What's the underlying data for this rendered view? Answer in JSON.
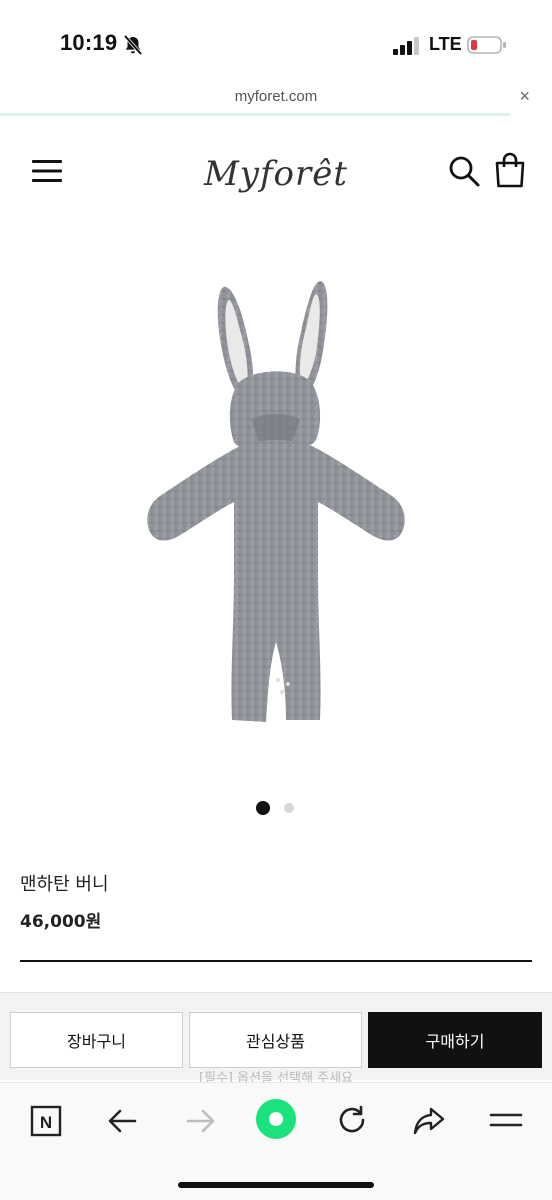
{
  "status_bar": {
    "time": "10:19",
    "network": "LTE",
    "battery_color": "#e0383e"
  },
  "url_bar": {
    "url": "myforet.com",
    "close": "×"
  },
  "header": {
    "logo_text": "Myforêt"
  },
  "gallery": {
    "image_alt": "gray bunny-ear hooded baby romper",
    "total_slides": 2,
    "active_slide": 1
  },
  "product": {
    "name": "맨하탄 버니",
    "price": "46,000원"
  },
  "actions": {
    "cart_label": "장바구니",
    "wish_label": "관심상품",
    "buy_label": "구매하기",
    "required_note": "[필수] 옵션을 선택해 주세요"
  },
  "toolbar": {
    "naver_label": "N",
    "accent_color": "#19e37a"
  }
}
